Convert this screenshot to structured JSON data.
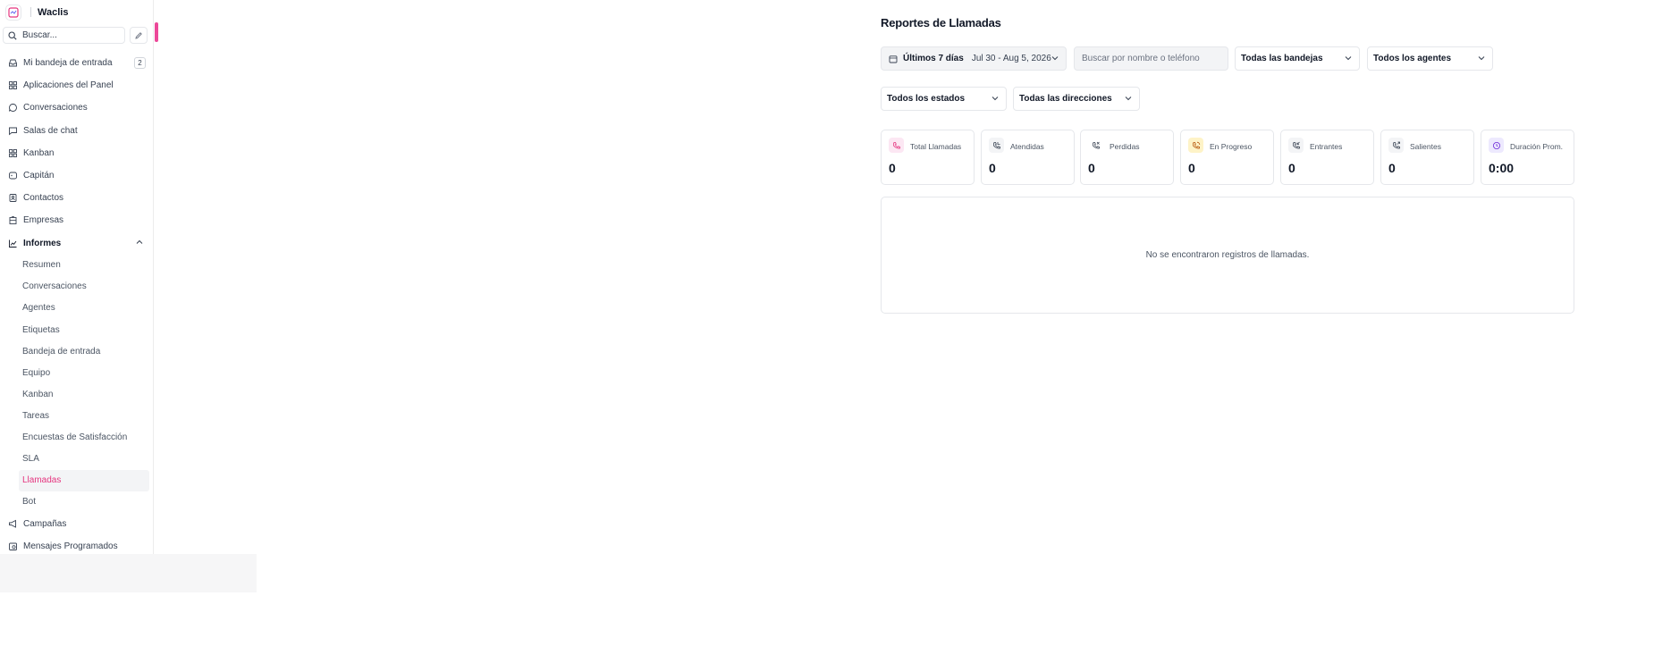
{
  "brand": {
    "name": "Waclis"
  },
  "search": {
    "placeholder": "Buscar..."
  },
  "nav": {
    "items": [
      {
        "label": "Mi bandeja de entrada",
        "badge": "2",
        "icon": "inbox-icon"
      },
      {
        "label": "Aplicaciones del Panel",
        "icon": "grid-icon"
      },
      {
        "label": "Conversaciones",
        "icon": "chat-bubble-icon"
      },
      {
        "label": "Salas de chat",
        "icon": "message-square-icon"
      },
      {
        "label": "Kanban",
        "icon": "kanban-icon"
      },
      {
        "label": "Capitán",
        "icon": "bot-icon"
      },
      {
        "label": "Contactos",
        "icon": "contacts-icon"
      },
      {
        "label": "Empresas",
        "icon": "building-icon"
      },
      {
        "label": "Informes",
        "icon": "chart-line-icon"
      }
    ],
    "reports_sub": [
      "Resumen",
      "Conversaciones",
      "Agentes",
      "Etiquetas",
      "Bandeja de entrada",
      "Equipo",
      "Kanban",
      "Tareas",
      "Encuestas de Satisfacción",
      "SLA",
      "Llamadas",
      "Bot"
    ],
    "bottom_items": [
      {
        "label": "Campañas",
        "icon": "megaphone-icon"
      },
      {
        "label": "Mensajes Programados",
        "icon": "calendar-clock-icon"
      }
    ]
  },
  "main": {
    "title": "Reportes de Llamadas",
    "filters": {
      "date_label": "Últimos 7 días",
      "date_range": "Jul 30 - Aug 5, 2026",
      "search_placeholder": "Buscar por nombre o teléfono",
      "inboxes": "Todas las bandejas",
      "agents": "Todos los agentes",
      "statuses": "Todos los estados",
      "directions": "Todas las direcciones"
    },
    "stats": [
      {
        "label": "Total Llamadas",
        "value": "0",
        "icon": "phone-icon"
      },
      {
        "label": "Atendidas",
        "value": "0",
        "icon": "phone-incoming-icon"
      },
      {
        "label": "Perdidas",
        "value": "0",
        "icon": "phone-missed-icon"
      },
      {
        "label": "En Progreso",
        "value": "0",
        "icon": "phone-ringing-icon"
      },
      {
        "label": "Entrantes",
        "value": "0",
        "icon": "phone-incoming-icon"
      },
      {
        "label": "Salientes",
        "value": "0",
        "icon": "phone-outgoing-icon"
      },
      {
        "label": "Duración Prom.",
        "value": "0:00",
        "icon": "clock-icon"
      }
    ],
    "empty_message": "No se encontraron registros de llamadas."
  },
  "colors": {
    "accent": "#e5357f",
    "active_bg": "#f3f4f6",
    "border": "#e5e7eb"
  }
}
